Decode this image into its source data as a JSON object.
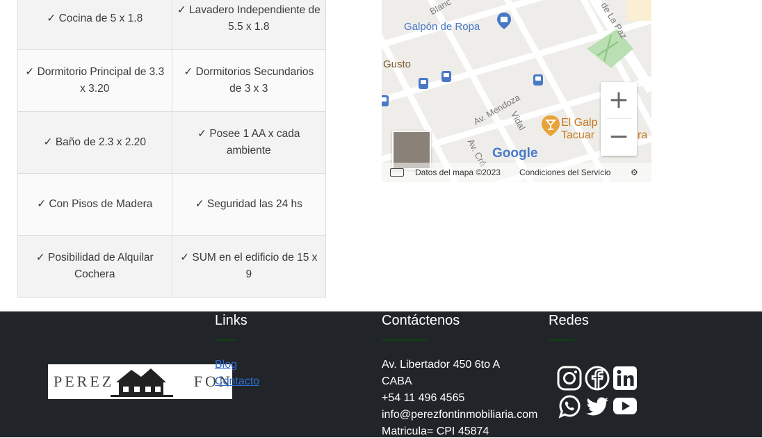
{
  "features": [
    [
      "✓ Cocina de 5 x 1.8",
      "✓ Lavadero Independiente de 5.5 x 1.8"
    ],
    [
      "✓ Dormitorio Principal de 3.3 x 3.20",
      "✓ Dormitorios Secundarios de 3 x 3"
    ],
    [
      "✓ Baño de 2.3 x 2.20",
      "✓ Posee 1 AA x cada ambiente"
    ],
    [
      "✓ Con Pisos de Madera",
      "✓ Seguridad las 24 hs"
    ],
    [
      "✓ Posibilidad de Alquilar Cochera",
      "✓ SUM en el edificio de 15 x 9"
    ]
  ],
  "map": {
    "labels": {
      "galpon": "Galpón de Ropa",
      "gusto": "Gusto",
      "el_galp": "El Galp",
      "tacuar": "Tacuar",
      "ra": "ra",
      "av_mendoza": "Av. Mendoza",
      "vidal": "Vidal",
      "av_cra": "Av. Crá",
      "de_la_paz": "de La Paz",
      "blanc": "Blanc",
      "google": "Google"
    },
    "zoom_in": "+",
    "zoom_out": "−",
    "data_label": "Datos del mapa ©2023",
    "terms": "Condiciones del Servicio"
  },
  "footer": {
    "logo_text": "PEREZ FONT",
    "links_title": "Links",
    "links": [
      "Blog",
      "Contacto"
    ],
    "contact_title": "Contáctenos",
    "contact": [
      "Av. Libertador 450 6to A",
      "CABA",
      "+54 11 496 4565",
      "info@perezfontinmobiliaria.com",
      "Matricula= CPI 45874"
    ],
    "social_title": "Redes",
    "social_icons": [
      "instagram-icon",
      "facebook-icon",
      "linkedin-icon",
      "whatsapp-icon",
      "twitter-icon",
      "youtube-icon"
    ],
    "accent": "#0f3e0f"
  }
}
